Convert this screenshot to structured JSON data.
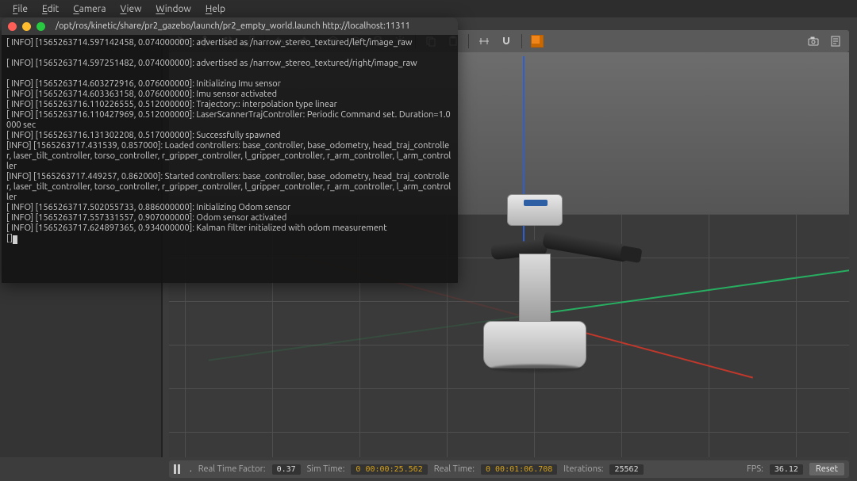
{
  "menubar": {
    "items": [
      {
        "label": "File",
        "accel": "F"
      },
      {
        "label": "Edit",
        "accel": "E"
      },
      {
        "label": "Camera",
        "accel": "C"
      },
      {
        "label": "View",
        "accel": "V"
      },
      {
        "label": "Window",
        "accel": "W"
      },
      {
        "label": "Help",
        "accel": "H"
      }
    ]
  },
  "toolbar": {
    "icons": [
      "cursor",
      "move",
      "rotate",
      "scale",
      "undo",
      "redo",
      "sep",
      "box",
      "sphere",
      "cylinder",
      "light",
      "sep",
      "copy",
      "paste",
      "sep",
      "align",
      "snap",
      "sep",
      "shade"
    ],
    "right_icons": [
      "camera",
      "log"
    ]
  },
  "statusbar": {
    "rtf_label": "Real Time Factor:",
    "rtf_value": "0.37",
    "sim_label": "Sim Time:",
    "sim_value": "0 00:00:25.562",
    "real_label": "Real Time:",
    "real_value": "0 00:01:06.708",
    "iter_label": "Iterations:",
    "iter_value": "25562",
    "fps_label": "FPS:",
    "fps_value": "36.12",
    "reset_label": "Reset"
  },
  "terminal": {
    "title": "/opt/ros/kinetic/share/pr2_gazebo/launch/pr2_empty_world.launch http://localhost:11311",
    "lines": [
      "[ INFO] [1565263714.597142458, 0.074000000]: advertised as /narrow_stereo_textured/left/image_raw",
      "",
      "[ INFO] [1565263714.597251482, 0.074000000]: advertised as /narrow_stereo_textured/right/image_raw",
      "",
      "[ INFO] [1565263714.603272916, 0.076000000]: Initializing Imu sensor",
      "[ INFO] [1565263714.603363158, 0.076000000]: Imu sensor activated",
      "[ INFO] [1565263716.110226555, 0.512000000]: Trajectory:: interpolation type linear",
      "[ INFO] [1565263716.110427969, 0.512000000]: LaserScannerTrajController: Periodic Command set. Duration=1.0000 sec",
      "[ INFO] [1565263716.131302208, 0.517000000]: Successfully spawned",
      "[INFO] [1565263717.431539, 0.857000]: Loaded controllers: base_controller, base_odometry, head_traj_controller, laser_tilt_controller, torso_controller, r_gripper_controller, l_gripper_controller, r_arm_controller, l_arm_controller",
      "[INFO] [1565263717.449257, 0.862000]: Started controllers: base_controller, base_odometry, head_traj_controller, laser_tilt_controller, torso_controller, r_gripper_controller, l_gripper_controller, r_arm_controller, l_arm_controller",
      "[ INFO] [1565263717.502055733, 0.886000000]: Initializing Odom sensor",
      "[ INFO] [1565263717.557331557, 0.907000000]: Odom sensor activated",
      "[ INFO] [1565263717.624897365, 0.934000000]: Kalman filter initialized with odom measurement"
    ]
  }
}
